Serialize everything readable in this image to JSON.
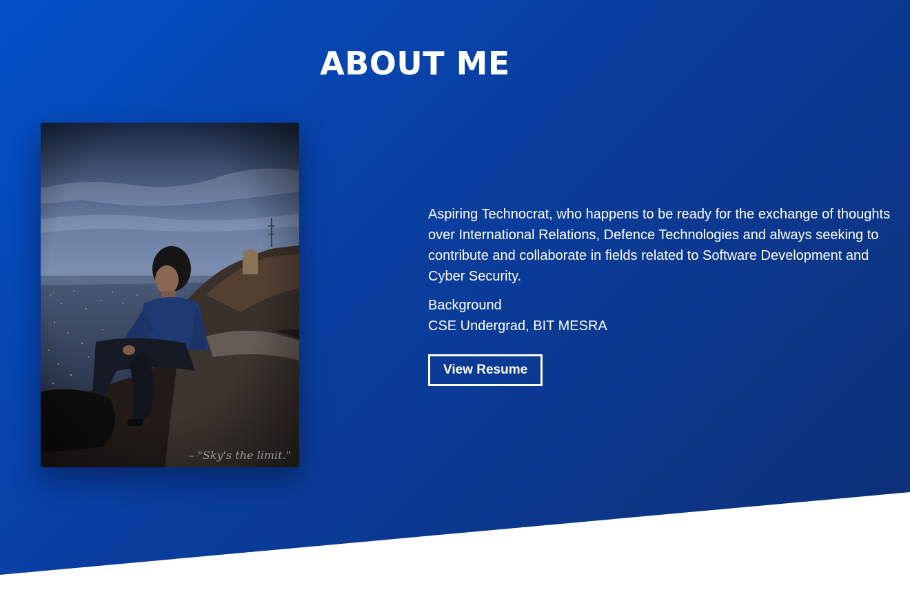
{
  "about": {
    "title": "ABOUT ME",
    "photo": {
      "caption": "– \"Sky's the limit.\""
    },
    "bio": "Aspiring Technocrat, who happens to be ready for the exchange of thoughts over International Relations, Defence Technologies and always seeking to contribute and collaborate in fields related to Software Development and Cyber Security.",
    "background_label": "Background",
    "background_value": "CSE Undergrad, BIT MESRA",
    "resume_button_label": "View Resume"
  },
  "colors": {
    "gradient_start": "#0350c8",
    "gradient_end": "#0d2f74",
    "text": "#ffffff",
    "page_background": "#ffffff"
  }
}
